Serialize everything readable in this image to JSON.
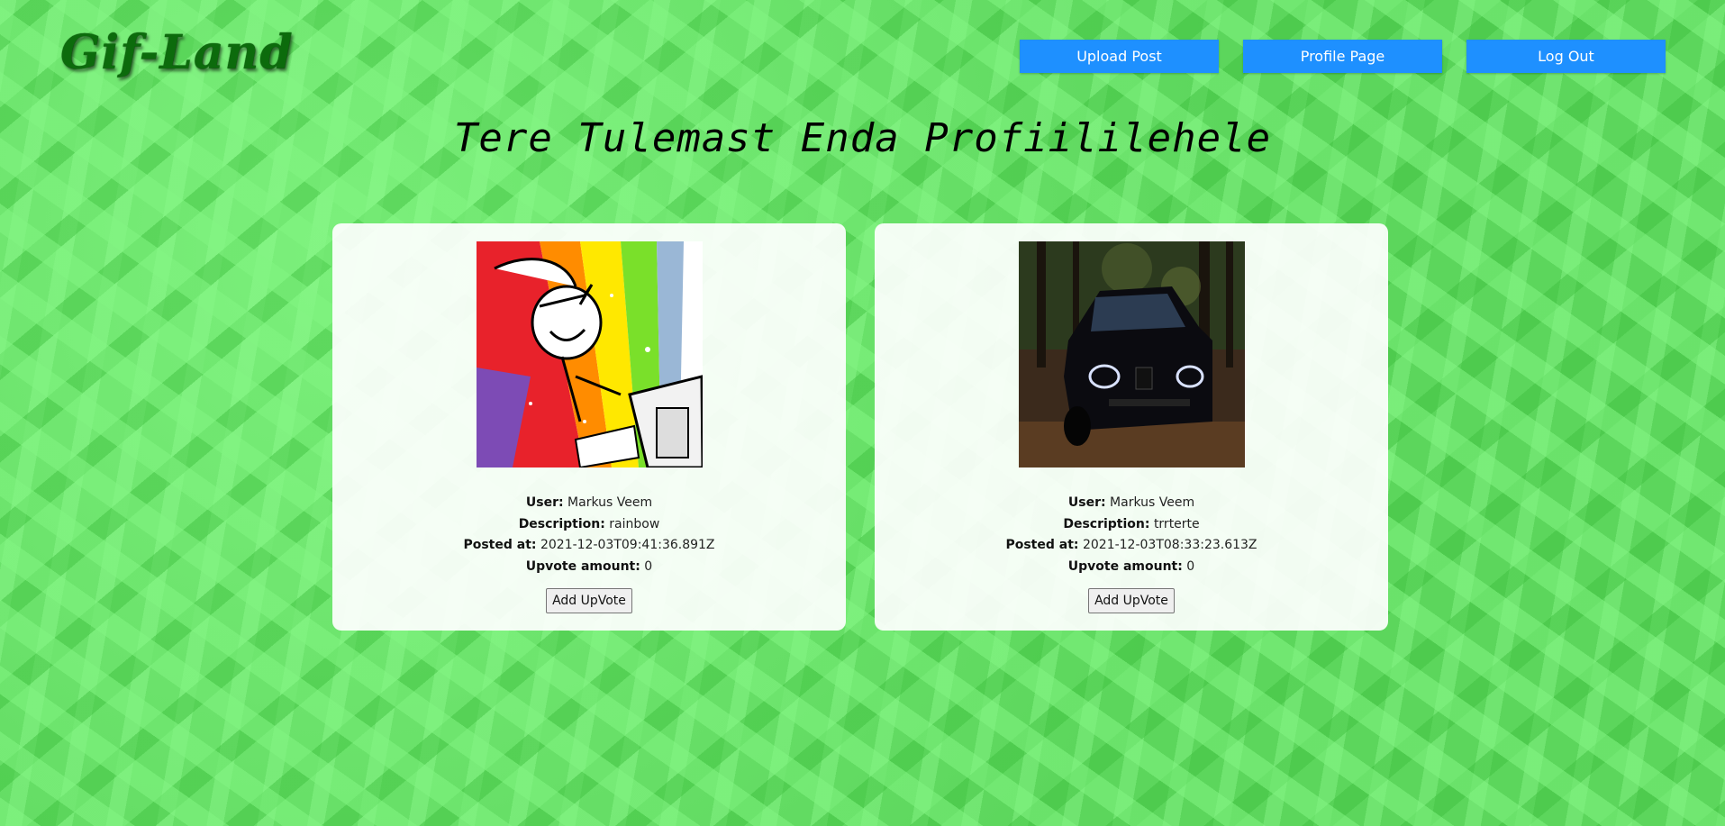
{
  "header": {
    "logo": "Gif-Land",
    "nav": [
      {
        "label": "Upload Post"
      },
      {
        "label": "Profile Page"
      },
      {
        "label": "Log Out"
      }
    ]
  },
  "page": {
    "title": "Tere Tulemast Enda Profiililehele"
  },
  "labels": {
    "user": "User:",
    "description": "Description:",
    "posted_at": "Posted at:",
    "upvote_amount": "Upvote amount:",
    "upvote_button": "Add UpVote"
  },
  "posts": [
    {
      "image": "rainbow-cartoon-gif",
      "user": "Markus Veem",
      "description": "rainbow",
      "posted_at": "2021-12-03T09:41:36.891Z",
      "upvotes": "0"
    },
    {
      "image": "black-car-forest-photo",
      "user": "Markus Veem",
      "description": "trrterte",
      "posted_at": "2021-12-03T08:33:23.613Z",
      "upvotes": "0"
    }
  ],
  "colors": {
    "background": "#63de63",
    "nav_button": "#1e90ff",
    "logo": "#0c6b0c"
  }
}
